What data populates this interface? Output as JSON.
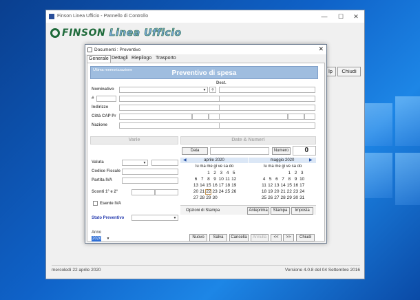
{
  "main_window": {
    "title": "Finson Linea Ufficio - Pannello di Controllo",
    "logo_brand": "FINSON",
    "logo_product": "Linea Ufficio",
    "side_buttons": {
      "help": "lp",
      "close": "Chiudi"
    },
    "status_left": "mercoledì 22 aprile 2020",
    "status_right": "Versione 4.0.8 del 04 Settembre 2016",
    "controls": {
      "minimize": "—",
      "maximize": "☐",
      "close": "✕"
    }
  },
  "dialog": {
    "title": "Documenti : Preventivo",
    "close": "✕",
    "tabs": [
      "Generale",
      "Dettagli",
      "Riepilogo",
      "Trasporto"
    ],
    "header_small": "Ultima memorizzazione",
    "header_title": "Preventivo di spesa",
    "dest_label": "Dest.",
    "labels": {
      "nominativo": "Nominativo",
      "numero": "#",
      "indirizzo": "Indirizzo",
      "citta": "Città CAP Pr",
      "nazione": "Nazione",
      "valuta": "Valuta",
      "codice_fiscale": "Codice Fiscale",
      "partita_iva": "Partita IVA",
      "sconti": "Sconti 1° e 2°",
      "esente_iva": "Esente IVA",
      "stato_preventivo": "Stato Preventivo",
      "anno": "Anno"
    },
    "section_varie": "Varie",
    "section_date": "Date & Numeri",
    "data_button": "Data",
    "numero_button": "Numero",
    "numero_value": "0",
    "anno_value": "2020",
    "calendar": {
      "months": [
        {
          "name": "aprile 2020",
          "dow": "lu ma me gi ve sa do",
          "weeks": [
            [
              "",
              "",
              "1",
              "2",
              "3",
              "4",
              "5"
            ],
            [
              "6",
              "7",
              "8",
              "9",
              "10",
              "11",
              "12"
            ],
            [
              "13",
              "14",
              "15",
              "16",
              "17",
              "18",
              "19"
            ],
            [
              "20",
              "21",
              "22",
              "23",
              "24",
              "25",
              "26"
            ],
            [
              "27",
              "28",
              "29",
              "30",
              "",
              "",
              ""
            ]
          ]
        },
        {
          "name": "maggio 2020",
          "dow": "lu ma me gi ve sa do",
          "weeks": [
            [
              "",
              "",
              "",
              "",
              "1",
              "2",
              "3"
            ],
            [
              "4",
              "5",
              "6",
              "7",
              "8",
              "9",
              "10"
            ],
            [
              "11",
              "12",
              "13",
              "14",
              "15",
              "16",
              "17"
            ],
            [
              "18",
              "19",
              "20",
              "21",
              "22",
              "23",
              "24"
            ],
            [
              "25",
              "26",
              "27",
              "28",
              "29",
              "30",
              "31"
            ]
          ]
        }
      ],
      "today": "22",
      "prev_arrow": "◀",
      "next_arrow": "▶"
    },
    "opzioni_label": "Opzioni di Stampa",
    "print_buttons": [
      "Anteprima",
      "Stampa",
      "Imposta"
    ],
    "bottom_buttons": [
      "Nuovo",
      "Salva",
      "Cancella",
      "Annulla",
      "<<",
      ">>",
      "Chiudi"
    ]
  }
}
